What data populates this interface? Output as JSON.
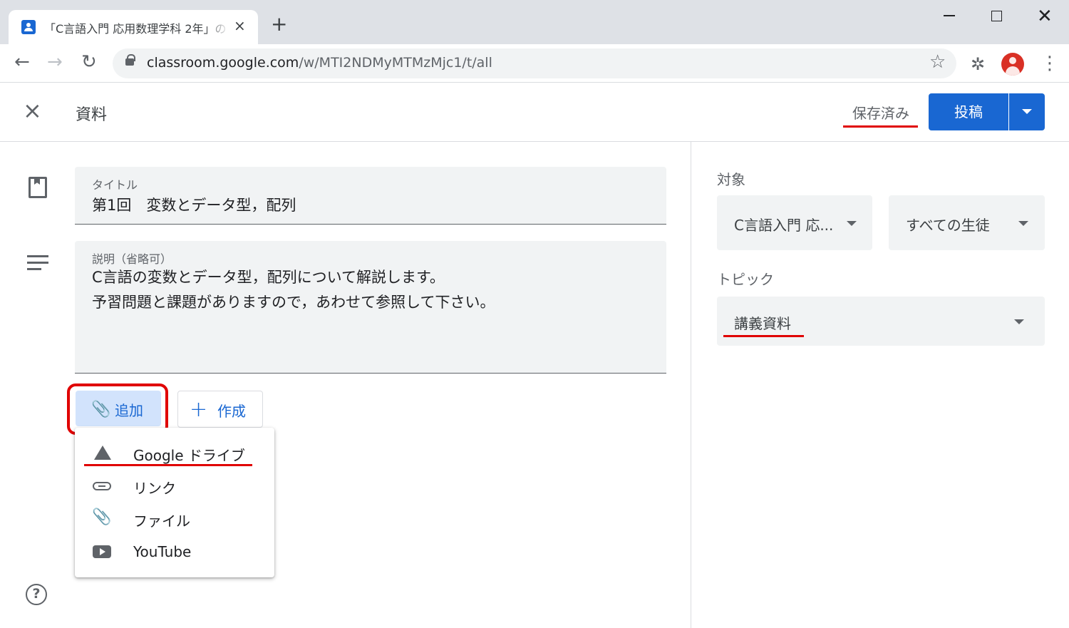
{
  "browser": {
    "tab_title": "「C言語入門 応用数理学科 2年」の",
    "tab_close": "×",
    "new_tab": "+",
    "url_prefix": "classroom.google.com",
    "url_path": "/w/MTI2NDMyMTMzMjc1/t/all"
  },
  "header": {
    "close_glyph": "×",
    "title": "資料",
    "saved_label": "保存済み",
    "post_label": "投稿"
  },
  "form": {
    "title_label": "タイトル",
    "title_value": "第1回　変数とデータ型，配列",
    "desc_label": "説明（省略可）",
    "desc_lines": [
      "C言語の変数とデータ型，配列について解説します。",
      "予習問題と課題がありますので，あわせて参照して下さい。"
    ],
    "add_label": "追加",
    "create_label": "作成"
  },
  "add_menu": {
    "items": [
      {
        "label": "Google ドライブ",
        "icon": "drive-icon"
      },
      {
        "label": "リンク",
        "icon": "link-icon"
      },
      {
        "label": "ファイル",
        "icon": "paperclip-icon"
      },
      {
        "label": "YouTube",
        "icon": "youtube-icon"
      }
    ]
  },
  "right_panel": {
    "target_label": "対象",
    "class_value": "C言語入門 応...",
    "students_value": "すべての生徒",
    "topic_label": "トピック",
    "topic_value": "講義資料"
  },
  "colors": {
    "accent": "#1967d2",
    "highlight": "#e00000"
  }
}
